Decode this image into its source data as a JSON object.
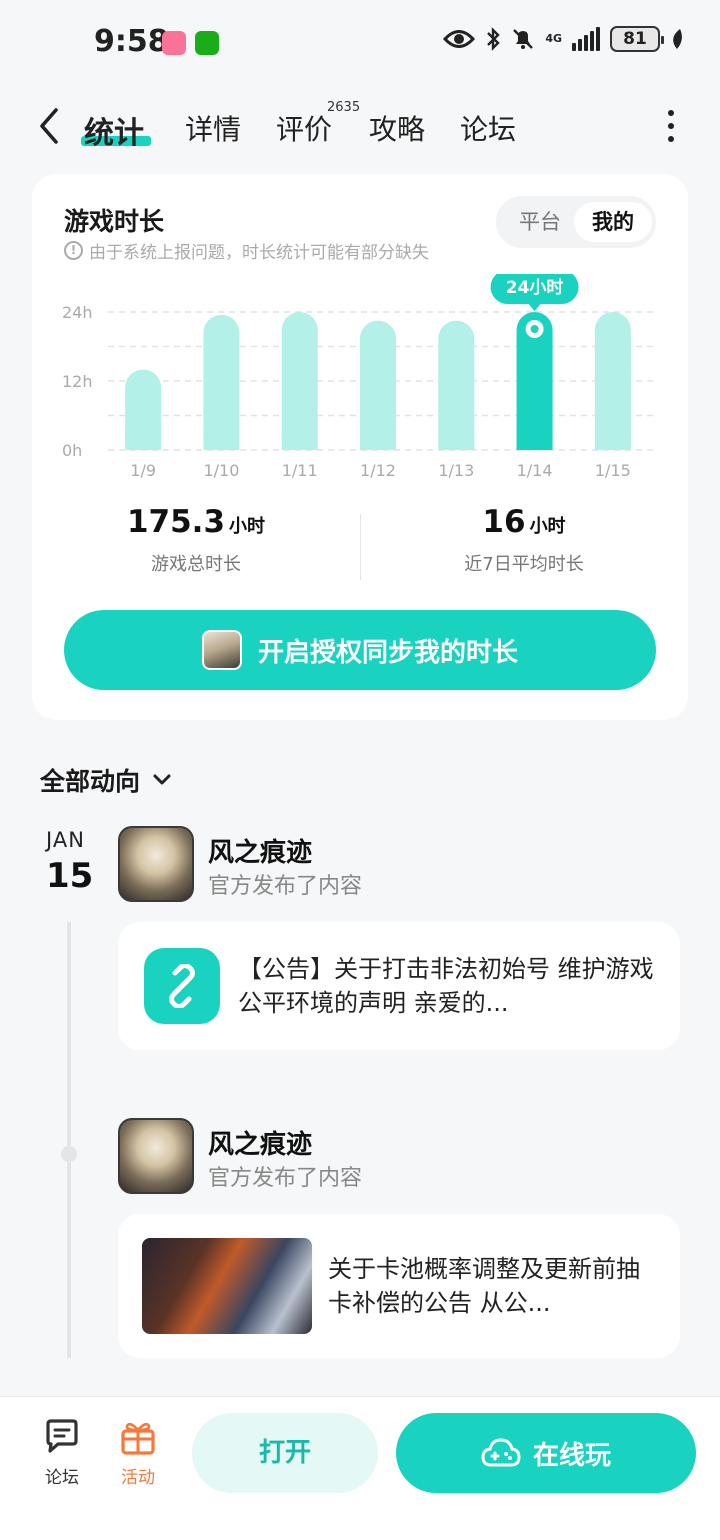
{
  "status_bar": {
    "time": "9:58",
    "battery": "81",
    "network": "4G",
    "icons": [
      "bilibili-icon",
      "wechat-icon",
      "eye-icon",
      "bluetooth-icon",
      "mute-bell-icon",
      "signal-icon",
      "battery-icon",
      "leaf-icon"
    ]
  },
  "nav": {
    "tabs": [
      {
        "label": "统计",
        "active": true
      },
      {
        "label": "详情"
      },
      {
        "label": "评价",
        "badge": "2635"
      },
      {
        "label": "攻略"
      },
      {
        "label": "论坛"
      }
    ]
  },
  "stats": {
    "title": "游戏时长",
    "note": "由于系统上报问题，时长统计可能有部分缺失",
    "toggle": {
      "platform": "平台",
      "mine": "我的",
      "selected": "我的"
    },
    "highlight_label": "24小时",
    "total": {
      "value": "175.3",
      "unit": "小时",
      "label": "游戏总时长"
    },
    "average": {
      "value": "16",
      "unit": "小时",
      "label": "近7日平均时长"
    },
    "sync_button": "开启授权同步我的时长"
  },
  "chart_data": {
    "type": "bar",
    "categories": [
      "1/9",
      "1/10",
      "1/11",
      "1/12",
      "1/13",
      "1/14",
      "1/15"
    ],
    "values": [
      14,
      23.5,
      24,
      22.5,
      22.5,
      24,
      24
    ],
    "ylim": [
      0,
      24
    ],
    "yticks": [
      "0h",
      "12h",
      "24h"
    ],
    "highlight_index": 5,
    "grid": true,
    "colors": {
      "bar": "#b2f0e8",
      "highlight": "#19d3c0"
    }
  },
  "activity": {
    "title": "全部动向",
    "date": {
      "month": "JAN",
      "day": "15"
    },
    "posts": [
      {
        "author": "风之痕迹",
        "action": "官方发布了内容",
        "text": "【公告】关于打击非法初始号 维护游戏公平环境的声明 亲爱的...",
        "kind": "link"
      },
      {
        "author": "风之痕迹",
        "action": "官方发布了内容",
        "text": "关于卡池概率调整及更新前抽卡补偿的公告 从公...",
        "kind": "image"
      }
    ]
  },
  "bottom_bar": {
    "forum": "论坛",
    "activity": "活动",
    "open": "打开",
    "play_online": "在线玩"
  },
  "colors": {
    "accent": "#19d3c0",
    "accent_light": "#b2f0e8",
    "activity_orange": "#f5793a"
  }
}
